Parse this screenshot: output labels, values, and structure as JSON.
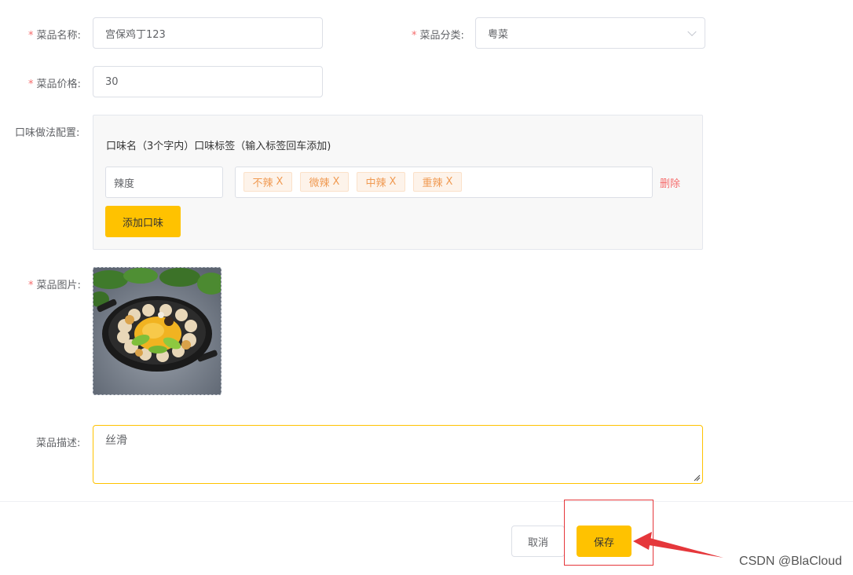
{
  "form": {
    "required_mark": "*",
    "name": {
      "label": "菜品名称:",
      "value": "宫保鸡丁123"
    },
    "category": {
      "label": "菜品分类:",
      "value": "粤菜"
    },
    "price": {
      "label": "菜品价格:",
      "value": "30"
    },
    "flavor": {
      "label": "口味做法配置:",
      "header": "口味名（3个字内）口味标签（输入标签回车添加)",
      "rows": [
        {
          "name": "辣度",
          "tags": [
            "不辣",
            "微辣",
            "中辣",
            "重辣"
          ],
          "tag_close": "X",
          "delete_label": "删除"
        }
      ],
      "add_label": "添加口味"
    },
    "image": {
      "label": "菜品图片:",
      "icon": "dish-photo"
    },
    "description": {
      "label": "菜品描述:",
      "value": "丝滑"
    }
  },
  "footer": {
    "cancel_label": "取消",
    "save_label": "保存"
  },
  "annotation": {
    "color": "#e5373b"
  },
  "watermark": "CSDN @BlaCloud",
  "colors": {
    "accent": "#ffc200",
    "required": "#f56c6c",
    "tag_bg": "#fdf3ea",
    "tag_text": "#f09a52"
  }
}
